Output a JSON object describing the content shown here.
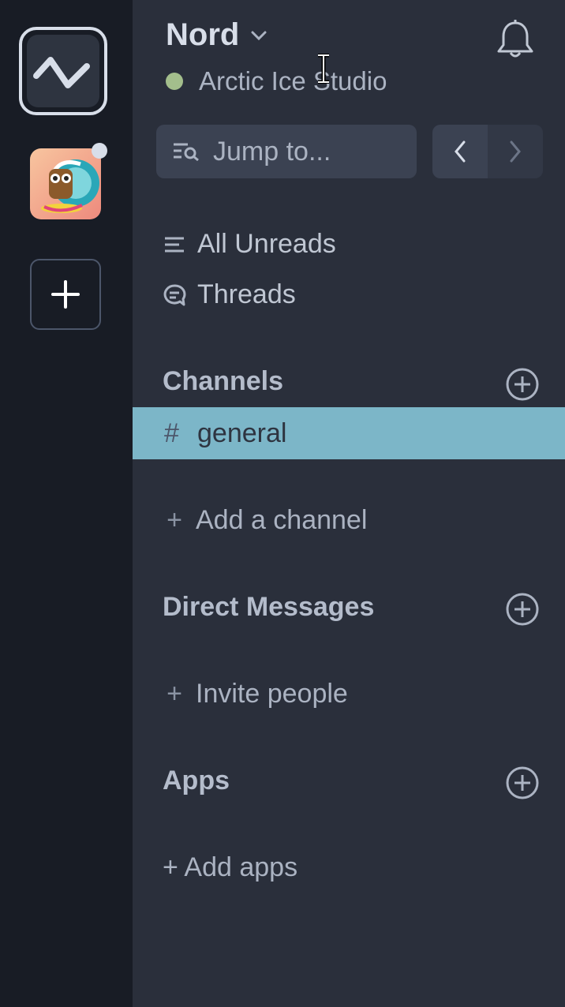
{
  "workspace": {
    "name": "Nord",
    "status": "Arctic Ice Studio"
  },
  "search": {
    "placeholder": "Jump to..."
  },
  "nav": {
    "all_unreads": "All Unreads",
    "threads": "Threads"
  },
  "channels": {
    "title": "Channels",
    "items": [
      {
        "name": "general",
        "prefix": "#"
      }
    ],
    "add_label": "Add a channel"
  },
  "direct_messages": {
    "title": "Direct Messages",
    "invite_label": "Invite people"
  },
  "apps": {
    "title": "Apps",
    "add_label": "+ Add apps"
  },
  "colors": {
    "rail_bg": "#181c25",
    "sidebar_bg": "#2a2f3b",
    "selected_bg": "#7cb6c8",
    "status_online": "#a3be8c"
  },
  "icons": [
    "workspace-logo-icon",
    "plus-icon",
    "chevron-down-icon",
    "bell-icon",
    "search-icon",
    "chevron-left-icon",
    "chevron-right-icon",
    "list-icon",
    "thread-icon",
    "hash-icon",
    "add-circle-icon",
    "text-cursor-icon"
  ]
}
